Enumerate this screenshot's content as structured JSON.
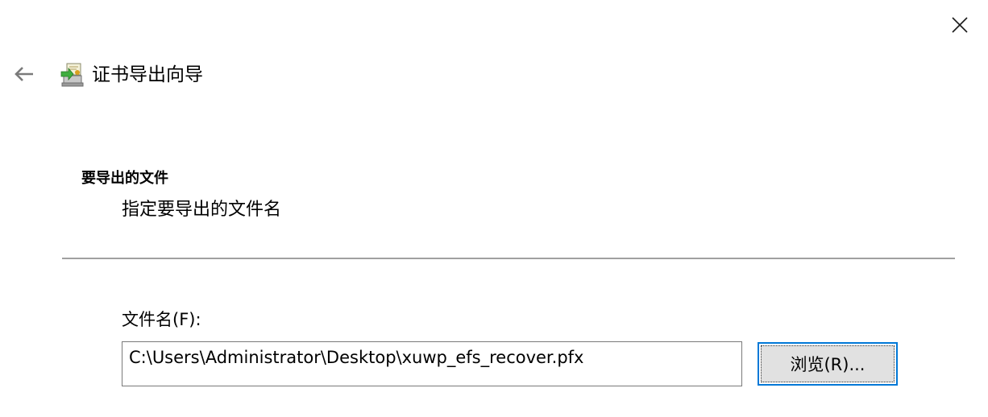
{
  "window": {
    "title": "证书导出向导"
  },
  "icons": {
    "close": "close-icon",
    "back": "back-arrow-icon",
    "wizard": "certificate-wizard-icon"
  },
  "page": {
    "heading": "要导出的文件",
    "description": "指定要导出的文件名"
  },
  "file_field": {
    "label": "文件名(F):",
    "value": "C:\\Users\\Administrator\\Desktop\\xuwp_efs_recover.pfx"
  },
  "browse_button": {
    "label": "浏览(R)..."
  },
  "colors": {
    "accent": "#0078d7",
    "divider": "#a0a0a0",
    "button_face": "#e1e1e1",
    "input_border": "#7a7a7a"
  }
}
